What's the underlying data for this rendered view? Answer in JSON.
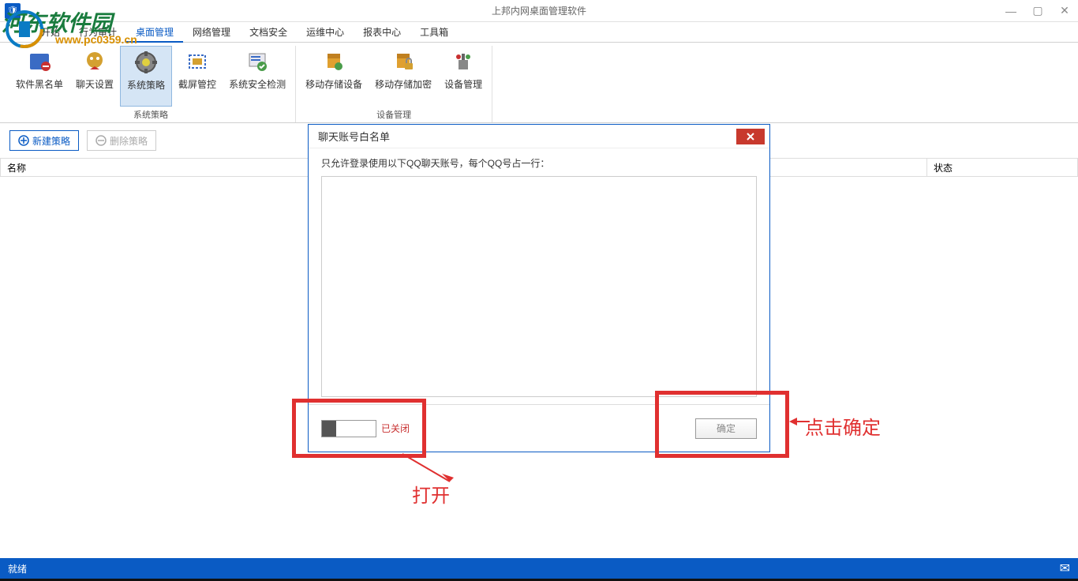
{
  "window": {
    "title": "上邦内网桌面管理软件",
    "controls": {
      "min": "—",
      "max": "▢",
      "close": "✕"
    }
  },
  "watermark": {
    "text1": "河东软件园",
    "text2": "www.pc0359.cn"
  },
  "menu": {
    "items": [
      "开始",
      "行为审计",
      "桌面管理",
      "网络管理",
      "文档安全",
      "运维中心",
      "报表中心",
      "工具箱"
    ],
    "active_index": 2
  },
  "ribbon": {
    "groups": [
      {
        "label": "系统策略",
        "items": [
          {
            "label": "软件黑名单",
            "icon": "blacklist-icon"
          },
          {
            "label": "聊天设置",
            "icon": "chat-icon"
          },
          {
            "label": "系统策略",
            "icon": "policy-icon",
            "active": true
          },
          {
            "label": "截屏管控",
            "icon": "screenshot-icon"
          },
          {
            "label": "系统安全检测",
            "icon": "security-icon"
          }
        ]
      },
      {
        "label": "设备管理",
        "items": [
          {
            "label": "移动存储设备",
            "icon": "storage-icon"
          },
          {
            "label": "移动存储加密",
            "icon": "encrypt-icon"
          },
          {
            "label": "设备管理",
            "icon": "device-icon"
          }
        ]
      }
    ]
  },
  "toolbar": {
    "new_policy": "新建策略",
    "delete_policy": "删除策略"
  },
  "table": {
    "header_name": "名称",
    "header_status": "状态"
  },
  "dialog": {
    "title": "聊天账号白名单",
    "hint": "只允许登录使用以下QQ聊天账号，每个QQ号占一行：",
    "textarea_value": "",
    "toggle_label": "已关闭",
    "ok_label": "确定"
  },
  "annotations": {
    "open": "打开",
    "click_ok": "点击确定"
  },
  "statusbar": {
    "ready": "就绪"
  },
  "icons": {
    "shield": "🛡"
  }
}
